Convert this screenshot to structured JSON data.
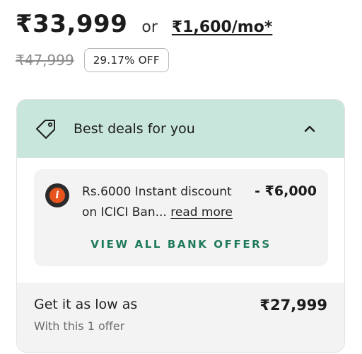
{
  "pricing": {
    "price": "₹33,999",
    "or": "or",
    "emi": "₹1,600/mo*",
    "mrp": "₹47,999",
    "discount": "29.17% OFF"
  },
  "deals": {
    "title": "Best deals for you",
    "offer": {
      "text": "Rs.6000 Instant discount on ICICI Ban...",
      "read_more": "read more",
      "amount": "- ₹6,000"
    },
    "view_all": "VIEW ALL BANK OFFERS",
    "lowest": {
      "label": "Get it as low as",
      "sub": "With this 1 offer",
      "price": "₹27,999"
    }
  },
  "icons": {
    "deals_icon": "tag-icon",
    "collapse_icon": "chevron-up-icon",
    "bank_icon": "icici-logo"
  },
  "colors": {
    "header_bg": "#c8e6dc",
    "accent": "#1f7a5c"
  }
}
